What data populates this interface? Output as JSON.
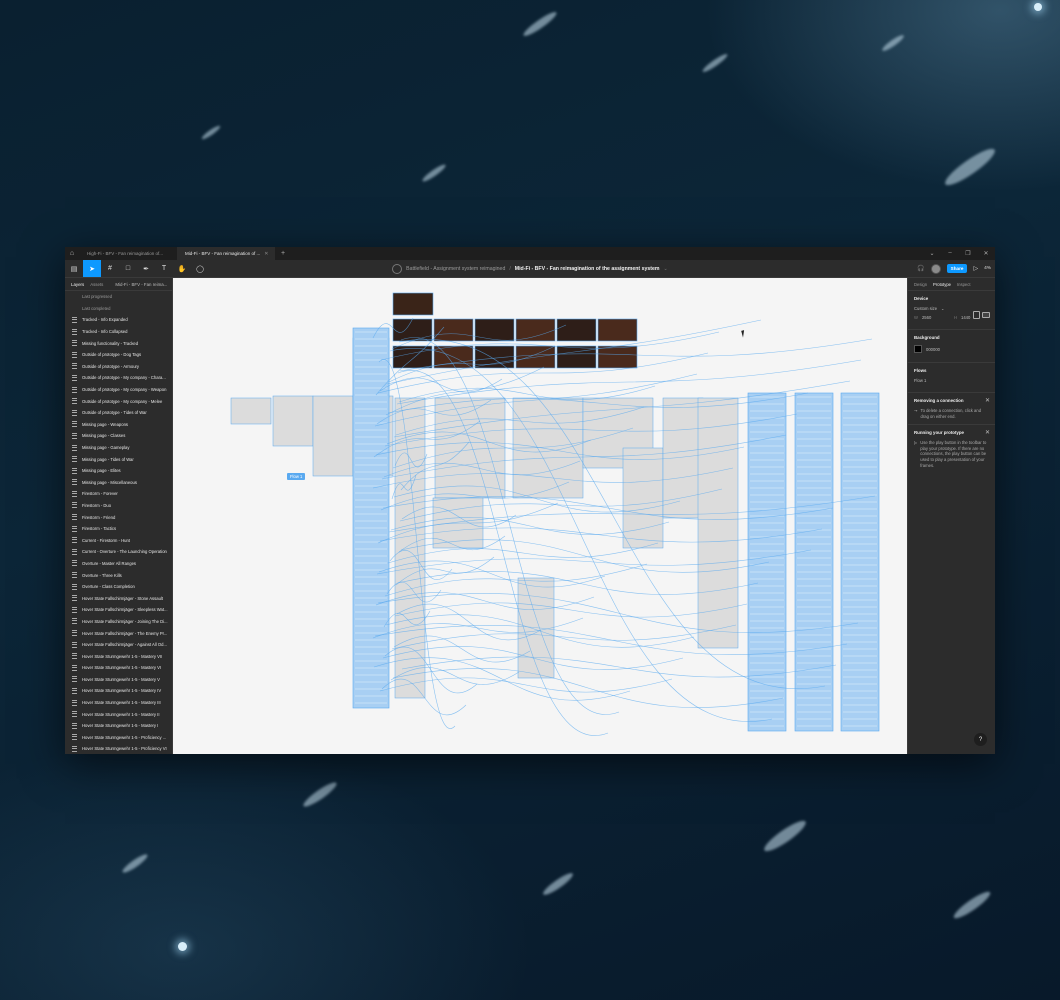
{
  "titlebar": {
    "tabs": [
      {
        "label": "High-Fi - BFV - Fan reimagination of..."
      },
      {
        "label": "Mid-Fi - BFV - Fan reimagination of ..."
      }
    ]
  },
  "toolbar": {
    "project": "Battlefield - Assignment system reimagined",
    "separator": "/",
    "file_name": "Mid-Fi - BFV - Fan reimagination of the assignment system",
    "share_label": "Share",
    "zoom": "4%"
  },
  "left_panel": {
    "tabs": {
      "layers": "Layers",
      "assets": "Assets",
      "page": "Mid-Fi - BFV - Fan reima..."
    },
    "sections": [
      "Last progressed",
      "Last completed"
    ],
    "layers": [
      "Tracked - Info Expanded",
      "Tracked - Info Collapsed",
      "Missing functionality - Tracked",
      "Outside of prototype - Dog Tags",
      "Outside of prototype - Armoury",
      "Outside of prototype - My company - Chara...",
      "Outside of prototype - My company - Weapon",
      "Outside of prototype - My company - Melee",
      "Outside of prototype - Tides of War",
      "Missing page - Weapons",
      "Missing page - Classes",
      "Missing page - Gameplay",
      "Missing page - Tides of War",
      "Missing page - Elites",
      "Missing page - Miscellaneous",
      "Firestorm - Forever",
      "Firestorm - Duo",
      "Firestorm - Friend",
      "Firestorm - Tactics",
      "Current - Firestorm - Hunt",
      "Current - Overture - The Launching Operation",
      "Overture - Master All Ranges",
      "Overture - Three Kills",
      "Overture - Class Completion",
      "Hover State Fallschirmjäger - Stone Assault",
      "Hover State Fallschirmjäger - Sleepless Wat...",
      "Hover State Fallschirmjäger - Joining The Di...",
      "Hover State Fallschirmjäger - The Enemy Pr...",
      "Hover State Fallschirmjäger - Against All Od...",
      "Hover State Sturmgewehr 1-5 - Mastery VII",
      "Hover State Sturmgewehr 1-5 - Mastery VI",
      "Hover State Sturmgewehr 1-5 - Mastery V",
      "Hover State Sturmgewehr 1-5 - Mastery IV",
      "Hover State Sturmgewehr 1-5 - Mastery III",
      "Hover State Sturmgewehr 1-5 - Mastery II",
      "Hover State Sturmgewehr 1-5 - Mastery I",
      "Hover State Sturmgewehr 1-5 - Proficiency ...",
      "Hover State Sturmgewehr 1-5 - Proficiency VI"
    ]
  },
  "right_panel": {
    "tabs": {
      "design": "Design",
      "prototype": "Prototype",
      "inspect": "Inspect"
    },
    "device": {
      "title": "Device",
      "value": "Custom size",
      "w_label": "W",
      "w": "2560",
      "h_label": "H",
      "h": "1440"
    },
    "background": {
      "title": "Background",
      "value": "000000",
      "color": "#000000"
    },
    "flows": {
      "title": "Flows",
      "item": "Flow 1"
    },
    "tip_remove": {
      "title": "Removing a connection",
      "body": "To delete a connection, click and drag on either end."
    },
    "tip_run": {
      "title": "Running your prototype",
      "body": "Use the play button in the toolbar to play your prototype. If there are no connections, the play button can be used to play a presentation of your frames."
    },
    "help": "?"
  },
  "canvas": {
    "flow_label": "Flow 1",
    "background": "#f5f5f5",
    "accent": "#59a9f0"
  }
}
